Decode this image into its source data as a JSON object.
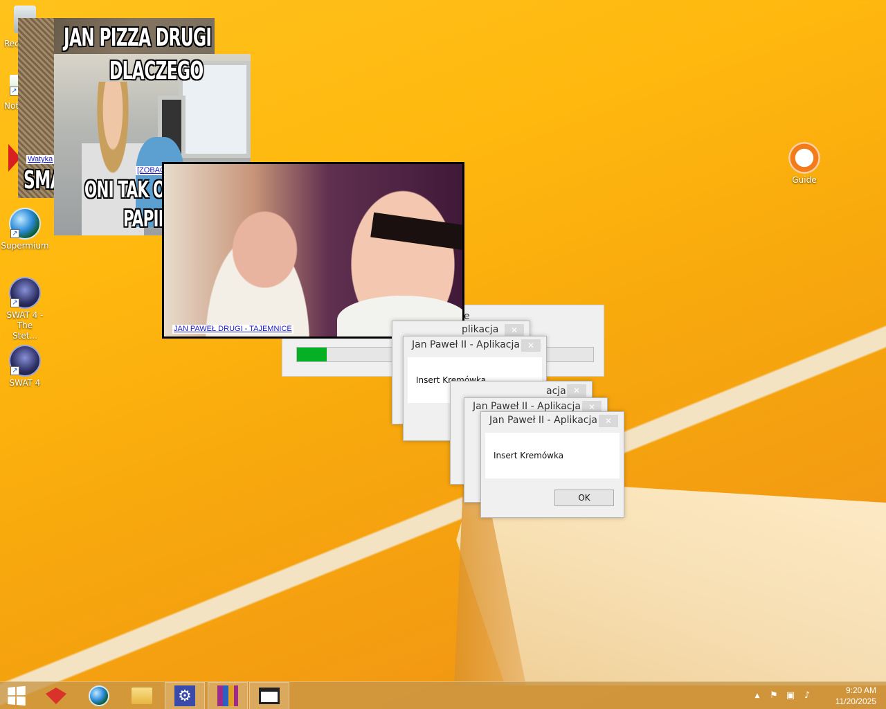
{
  "desktop": {
    "icons": [
      {
        "label": "Rec",
        "glyph": "recycle-bin-icon"
      },
      {
        "label": "Not",
        "glyph": "notepad-icon"
      },
      {
        "label": "Supermium",
        "glyph": "supermium-icon"
      },
      {
        "label": "SWAT 4 - The Stet...",
        "glyph": "swat4-stetchkov-icon"
      },
      {
        "label": "SWAT 4",
        "glyph": "swat4-icon"
      },
      {
        "label": "Guide",
        "glyph": "guide-icon"
      }
    ]
  },
  "popups": {
    "img1": {
      "caption_top": "JAN PIZZA DRUGI",
      "caption_bottom": "SMA",
      "link": "Watyka"
    },
    "img2": {
      "caption_top": "DLACZEGO",
      "caption_bottom_1": "ONI TAK OBRAŻAJĄ",
      "caption_bottom_2": "PAPIEŻA",
      "link": "[ZOBACZ]"
    },
    "img3": {
      "link": "JAN PAWEŁ DRUGI - TAJEMNICE"
    }
  },
  "progress_dialog": {
    "title": "e",
    "progress": 0.1
  },
  "dialogs": [
    {
      "title": "plikacja",
      "message": "",
      "ok": ""
    },
    {
      "title": "Jan Paweł II - Aplikacja",
      "message": "Insert Kremówka",
      "ok": ""
    },
    {
      "title": "acja",
      "message": "",
      "ok": ""
    },
    {
      "title": "Jan Paweł II - Aplikacja",
      "message": "",
      "ok": ""
    },
    {
      "title": "Jan Paweł II - Aplikacja",
      "message": "Insert Kremówka",
      "ok": "OK"
    }
  ],
  "dialog_close_glyph": "✕",
  "taskbar": {
    "items": [
      {
        "name": "start",
        "icon": "windows-logo-icon"
      },
      {
        "name": "app-1",
        "icon": "red-box-icon"
      },
      {
        "name": "app-2",
        "icon": "supermium-icon"
      },
      {
        "name": "app-3",
        "icon": "file-explorer-icon"
      },
      {
        "name": "app-4",
        "icon": "settings-gear-icon"
      },
      {
        "name": "app-5",
        "icon": "winrar-icon"
      },
      {
        "name": "app-6",
        "icon": "window-icon"
      }
    ],
    "clock_time": "9:20 AM",
    "clock_date": "11/20/2025",
    "tray_up": "▲"
  }
}
